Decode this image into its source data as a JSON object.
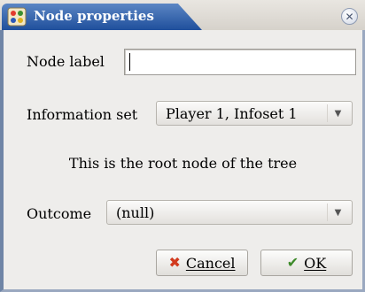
{
  "window": {
    "title": "Node properties",
    "icon": "gambit-app-icon",
    "close_icon": "close-icon"
  },
  "form": {
    "node_label": {
      "label": "Node label",
      "value": ""
    },
    "information_set": {
      "label": "Information set",
      "selected": "Player 1, Infoset 1"
    },
    "info_message": "This is the root node of the tree",
    "outcome": {
      "label": "Outcome",
      "selected": "(null)"
    }
  },
  "buttons": {
    "cancel_label": "Cancel",
    "cancel_icon": "cancel-x-icon",
    "ok_label": "OK",
    "ok_icon": "checkmark-icon"
  },
  "colors": {
    "title_bar": "#2d5aa8",
    "cancel_icon": "#d23a1e",
    "ok_icon": "#3d8a2a"
  }
}
